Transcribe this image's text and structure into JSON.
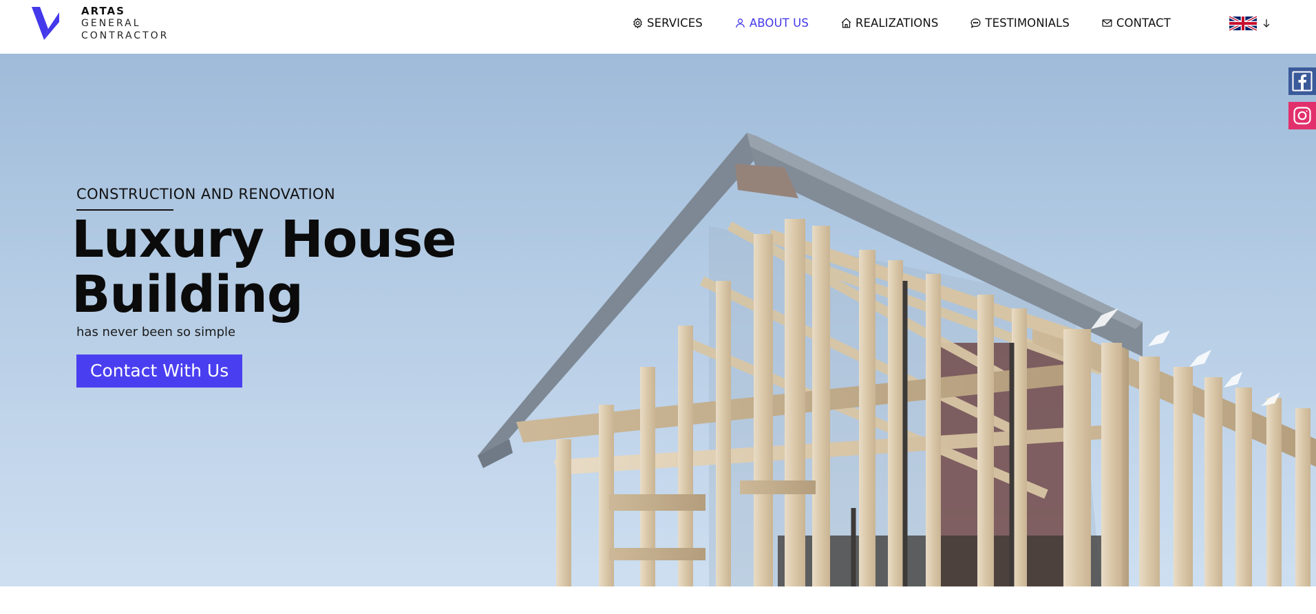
{
  "brand": {
    "line1": "ARTAS",
    "line2": "GENERAL",
    "line3": "CONTRACTOR",
    "accent": "#4338ea"
  },
  "nav": {
    "items": [
      {
        "label": "SERVICES",
        "icon": "gear-icon"
      },
      {
        "label": "ABOUT US",
        "icon": "user-icon",
        "active": true
      },
      {
        "label": "REALIZATIONS",
        "icon": "home-icon"
      },
      {
        "label": "TESTIMONIALS",
        "icon": "chat-icon"
      },
      {
        "label": "CONTACT",
        "icon": "mail-icon"
      }
    ]
  },
  "language": {
    "flag": "uk-flag-icon",
    "arrow": "arrow-down-icon"
  },
  "hero": {
    "eyebrow": "CONSTRUCTION AND RENOVATION",
    "headline_line1": "Luxury House",
    "headline_line2": "Building",
    "subline": "has never been so simple",
    "cta_label": "Contact With Us"
  },
  "social": [
    {
      "name": "facebook-icon",
      "color": "#3b5a9a"
    },
    {
      "name": "instagram-icon",
      "color": "#e1306c"
    }
  ]
}
